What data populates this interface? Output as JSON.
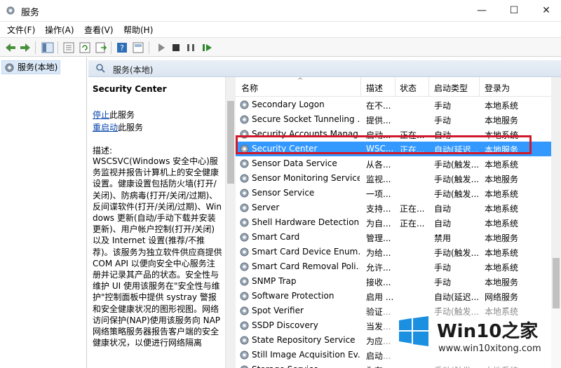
{
  "window": {
    "title": "服务",
    "minimize": "—",
    "maximize": "☐",
    "close": "✕"
  },
  "menu": [
    "文件(F)",
    "操作(A)",
    "查看(V)",
    "帮助(H)"
  ],
  "tree": {
    "item": "服务(本地)"
  },
  "pane": {
    "header": "服务(本地)"
  },
  "details": {
    "title": "Security Center",
    "stop_link": "停止",
    "stop_suffix": "此服务",
    "restart_link": "重启动",
    "restart_suffix": "此服务",
    "desc_label": "描述:",
    "description": "WSCSVC(Windows 安全中心)服务监视并报告计算机上的安全健康设置。健康设置包括防火墙(打开/关闭)、防病毒(打开/关闭/过期)、反间谍软件(打开/关闭/过期)、Windows 更新(自动/手动下载并安装更新)、用户帐户控制(打开/关闭)以及 Internet 设置(推荐/不推荐)。该服务为独立软件供应商提供 COM API 以便向安全中心服务注册并记录其产品的状态。安全性与维护 UI 使用该服务在\"安全性与维护\"控制面板中提供 systray 警报和安全健康状况的图形视图。网络访问保护(NAP)使用该服务向 NAP 网络策略服务器报告客户端的安全健康状况，以便进行网络隔离"
  },
  "columns": {
    "name": "名称",
    "desc": "描述",
    "status": "状态",
    "startup": "启动类型",
    "logon": "登录为",
    "sort_indicator": "^"
  },
  "services": [
    {
      "name": "Secondary Logon",
      "desc": "在不...",
      "status": "",
      "startup": "手动",
      "logon": "本地系统"
    },
    {
      "name": "Secure Socket Tunneling ...",
      "desc": "提供...",
      "status": "",
      "startup": "手动",
      "logon": "本地服务"
    },
    {
      "name": "Security Accounts Manag...",
      "desc": "启动...",
      "status": "正在...",
      "startup": "自动",
      "logon": "本地系统"
    },
    {
      "name": "Security Center",
      "desc": "WSC...",
      "status": "正在...",
      "startup": "自动(延迟...",
      "logon": "本地服务"
    },
    {
      "name": "Sensor Data Service",
      "desc": "从各...",
      "status": "",
      "startup": "手动(触发...",
      "logon": "本地系统"
    },
    {
      "name": "Sensor Monitoring Service",
      "desc": "监视...",
      "status": "",
      "startup": "手动(触发...",
      "logon": "本地服务"
    },
    {
      "name": "Sensor Service",
      "desc": "一项...",
      "status": "",
      "startup": "手动(触发...",
      "logon": "本地系统"
    },
    {
      "name": "Server",
      "desc": "支持...",
      "status": "正在...",
      "startup": "自动",
      "logon": "本地系统"
    },
    {
      "name": "Shell Hardware Detection",
      "desc": "为自...",
      "status": "正在...",
      "startup": "自动",
      "logon": "本地系统"
    },
    {
      "name": "Smart Card",
      "desc": "管理...",
      "status": "",
      "startup": "禁用",
      "logon": "本地服务"
    },
    {
      "name": "Smart Card Device Enum...",
      "desc": "为给...",
      "status": "",
      "startup": "手动(触发...",
      "logon": "本地系统"
    },
    {
      "name": "Smart Card Removal Poli...",
      "desc": "允许...",
      "status": "",
      "startup": "手动",
      "logon": "本地系统"
    },
    {
      "name": "SNMP Trap",
      "desc": "接收...",
      "status": "",
      "startup": "手动",
      "logon": "本地服务"
    },
    {
      "name": "Software Protection",
      "desc": "启用 ...",
      "status": "",
      "startup": "自动(延迟...",
      "logon": "网络服务"
    },
    {
      "name": "Spot Verifier",
      "desc": "验证...",
      "status": "",
      "startup": "手动(触发...",
      "logon": "本地系统"
    },
    {
      "name": "SSDP Discovery",
      "desc": "当发...",
      "status": "",
      "startup": "",
      "logon": ""
    },
    {
      "name": "State Repository Service",
      "desc": "为应...",
      "status": "",
      "startup": "",
      "logon": ""
    },
    {
      "name": "Still Image Acquisition Ev...",
      "desc": "启动...",
      "status": "",
      "startup": "",
      "logon": ""
    },
    {
      "name": "Storage Service",
      "desc": "为存...",
      "status": "",
      "startup": "手动(触发...",
      "logon": "本地系统"
    }
  ],
  "selected_index": 3,
  "watermark": {
    "title": "Win10",
    "title_zh": "之家",
    "url": "www.win10xitong.com"
  },
  "colors": {
    "selection": "#3399ff",
    "highlight_box": "#d0182a",
    "link": "#0645ad",
    "pane_header": "#dbe5f1"
  }
}
